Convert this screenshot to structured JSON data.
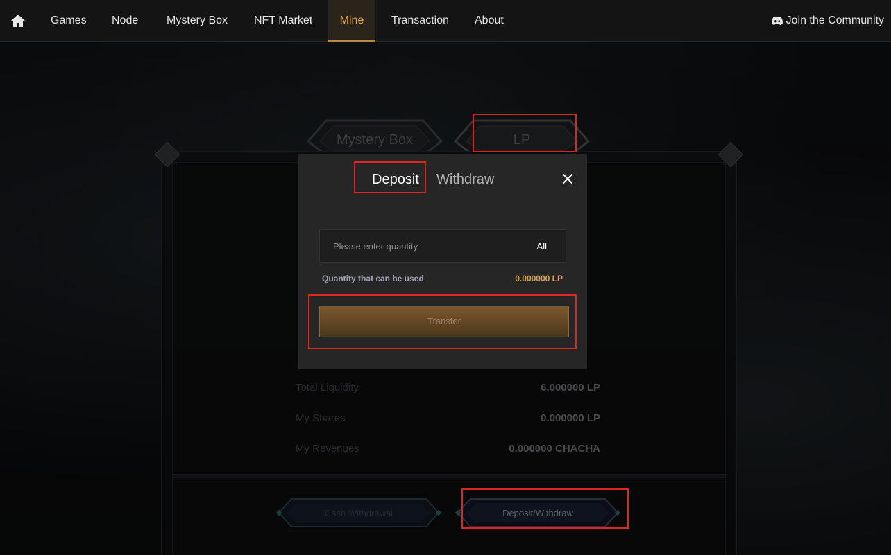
{
  "nav": {
    "items": [
      {
        "label": "Games"
      },
      {
        "label": "Node"
      },
      {
        "label": "Mystery Box"
      },
      {
        "label": "NFT Market"
      },
      {
        "label": "Mine"
      },
      {
        "label": "Transaction"
      },
      {
        "label": "About"
      }
    ],
    "active": "Mine",
    "community_label": "Join the Community",
    "home_icon": "home-icon",
    "community_icon": "discord-icon"
  },
  "panel": {
    "tabs": [
      {
        "label": "Mystery Box"
      },
      {
        "label": "LP"
      }
    ],
    "stats": [
      {
        "label": "Total Liquidity",
        "value": "6.000000 LP"
      },
      {
        "label": "My Shares",
        "value": "0.000000 LP"
      },
      {
        "label": "My Revenues",
        "value": "0.000000 CHACHA"
      }
    ],
    "buttons": {
      "cash_withdrawal": "Cash Withdrawal",
      "deposit_withdraw": "Deposit/Withdraw"
    }
  },
  "modal": {
    "tabs": {
      "deposit": "Deposit",
      "withdraw": "Withdraw"
    },
    "close_icon": "close-icon",
    "quantity": {
      "placeholder": "Please enter quantity",
      "value": "",
      "all_label": "All"
    },
    "usable": {
      "label": "Quantity that can be used",
      "value": "0.000000 LP"
    },
    "transfer_label": "Transfer"
  },
  "colors": {
    "accent": "#e3a84e",
    "highlight": "#e0241f",
    "usable_value": "#d9a63d"
  }
}
